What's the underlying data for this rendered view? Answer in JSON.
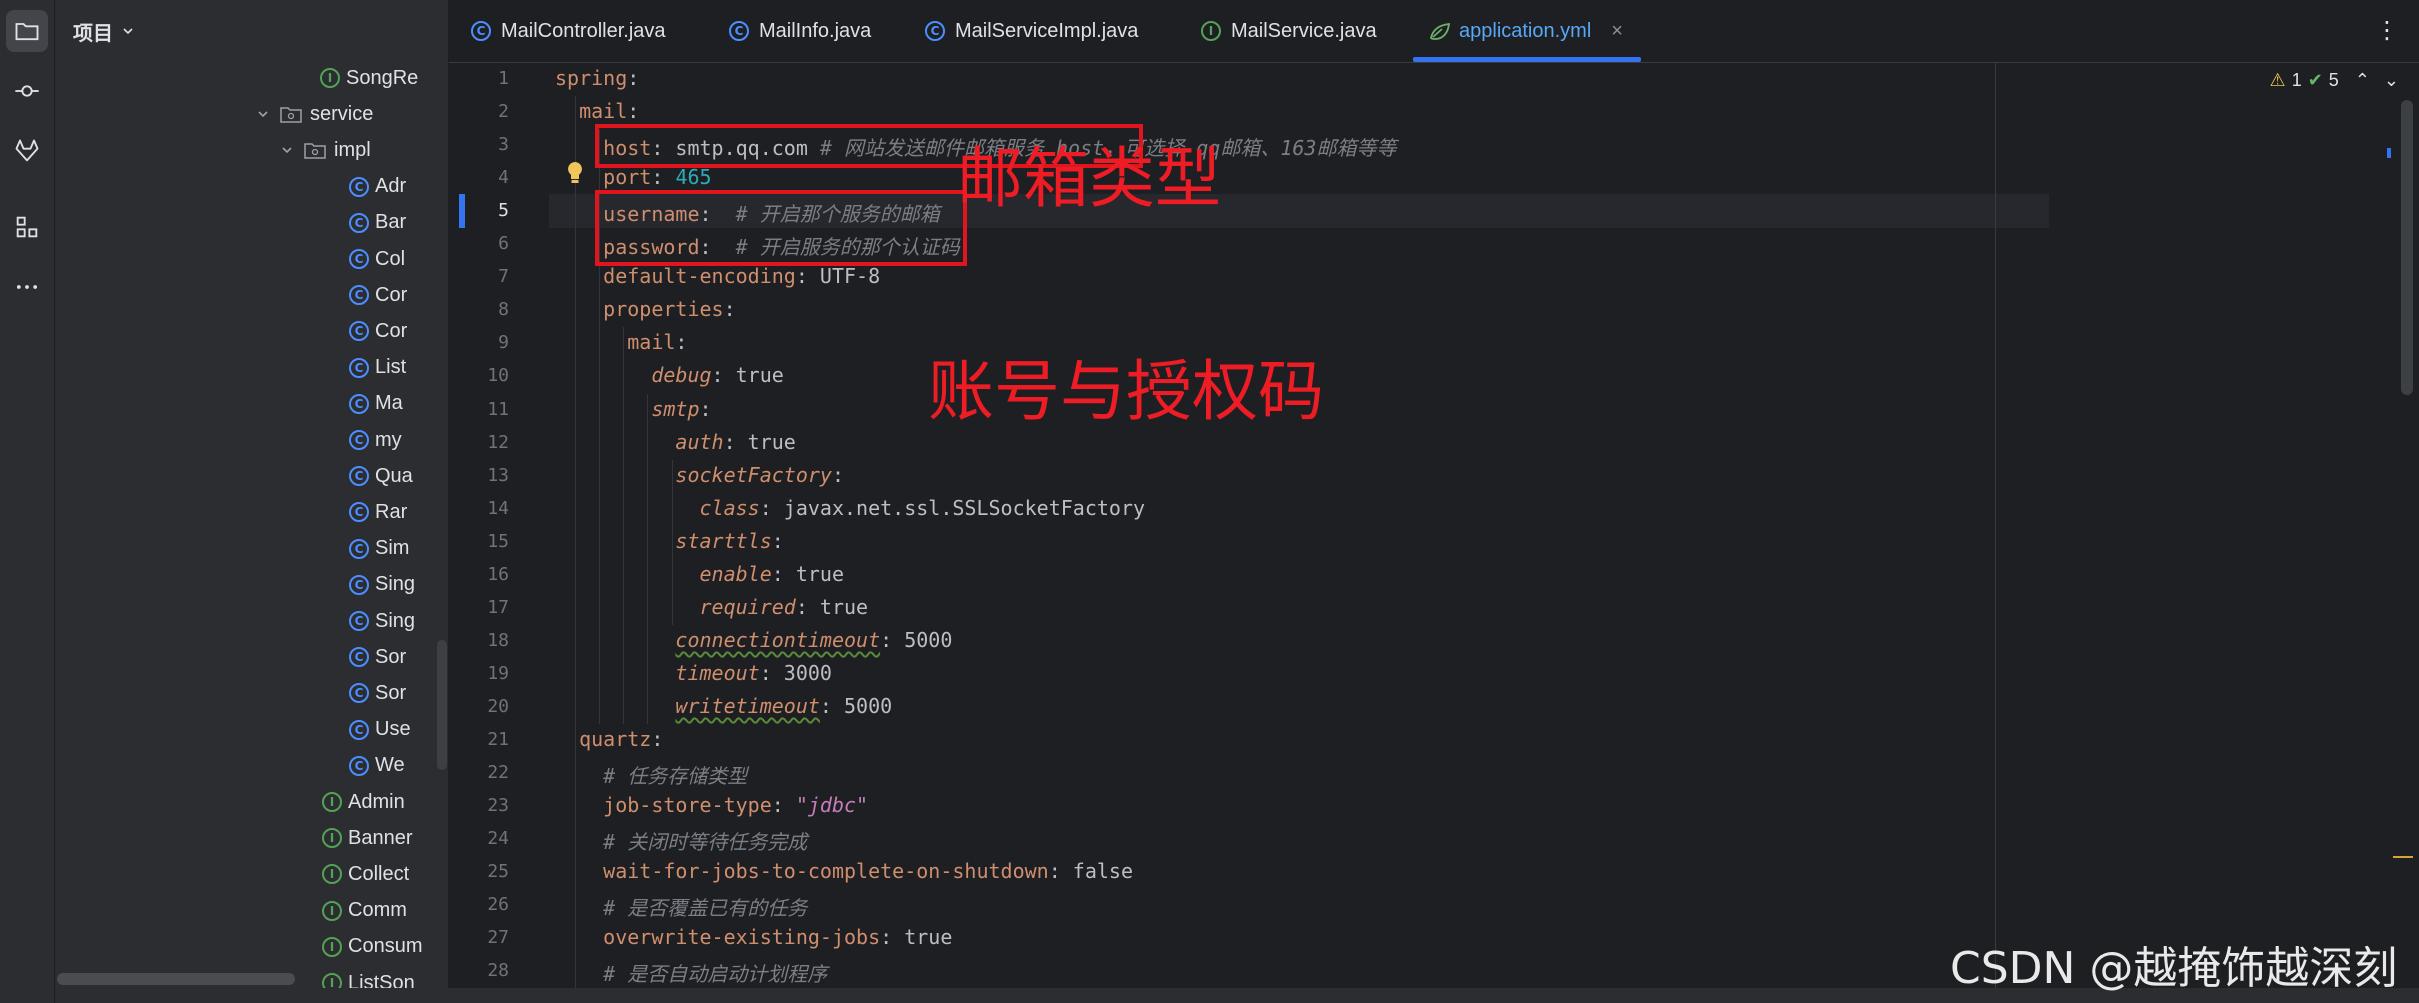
{
  "sidebar": {
    "icons": [
      "folder-icon",
      "commit-icon",
      "gitlab-icon",
      "structure-icon",
      "more-icon"
    ]
  },
  "project": {
    "title": "项目",
    "tree": [
      {
        "kind": "interface",
        "label": "SongRe",
        "depth": 3
      },
      {
        "kind": "package",
        "label": "service",
        "depth": 1,
        "expanded": true
      },
      {
        "kind": "package",
        "label": "impl",
        "depth": 2,
        "expanded": true
      },
      {
        "kind": "class",
        "label": "Adr",
        "depth": 3
      },
      {
        "kind": "class",
        "label": "Bar",
        "depth": 3
      },
      {
        "kind": "class",
        "label": "Col",
        "depth": 3
      },
      {
        "kind": "class",
        "label": "Cor",
        "depth": 3
      },
      {
        "kind": "class",
        "label": "Cor",
        "depth": 3
      },
      {
        "kind": "class",
        "label": "List",
        "depth": 3
      },
      {
        "kind": "class",
        "label": "Ma",
        "depth": 3
      },
      {
        "kind": "class",
        "label": "my",
        "depth": 3
      },
      {
        "kind": "class",
        "label": "Qua",
        "depth": 3
      },
      {
        "kind": "class",
        "label": "Rar",
        "depth": 3
      },
      {
        "kind": "class",
        "label": "Sim",
        "depth": 3
      },
      {
        "kind": "class",
        "label": "Sing",
        "depth": 3
      },
      {
        "kind": "class",
        "label": "Sing",
        "depth": 3
      },
      {
        "kind": "class",
        "label": "Sor",
        "depth": 3
      },
      {
        "kind": "class",
        "label": "Sor",
        "depth": 3
      },
      {
        "kind": "class",
        "label": "Use",
        "depth": 3
      },
      {
        "kind": "class",
        "label": "We",
        "depth": 3
      },
      {
        "kind": "interface",
        "label": "Admin",
        "depth": 2
      },
      {
        "kind": "interface",
        "label": "Banner",
        "depth": 2
      },
      {
        "kind": "interface",
        "label": "Collect",
        "depth": 2
      },
      {
        "kind": "interface",
        "label": "Comm",
        "depth": 2
      },
      {
        "kind": "interface",
        "label": "Consum",
        "depth": 2
      },
      {
        "kind": "interface",
        "label": "ListSon",
        "depth": 2
      }
    ]
  },
  "tabs": [
    {
      "label": "MailController.java",
      "kind": "class",
      "active": false
    },
    {
      "label": "MailInfo.java",
      "kind": "class",
      "active": false
    },
    {
      "label": "MailServiceImpl.java",
      "kind": "class",
      "active": false
    },
    {
      "label": "MailService.java",
      "kind": "interface",
      "active": false
    },
    {
      "label": "application.yml",
      "kind": "yaml",
      "active": true
    }
  ],
  "inspections": {
    "warnings": "1",
    "ok": "5"
  },
  "editor": {
    "current_line": 5,
    "lines": [
      [
        [
          "k",
          "spring"
        ],
        [
          "p",
          ":"
        ]
      ],
      [
        [
          "p",
          "  "
        ],
        [
          "k",
          "mail"
        ],
        [
          "p",
          ":"
        ]
      ],
      [
        [
          "p",
          "    "
        ],
        [
          "k",
          "host"
        ],
        [
          "p",
          ": smtp.qq.com "
        ],
        [
          "c",
          "# 网站发送邮件邮箱服务 host，可选择 qq邮箱、163邮箱等等"
        ]
      ],
      [
        [
          "p",
          "    "
        ],
        [
          "k",
          "port"
        ],
        [
          "p",
          ": "
        ],
        [
          "n",
          "465"
        ]
      ],
      [
        [
          "p",
          "    "
        ],
        [
          "k",
          "username"
        ],
        [
          "p",
          ":  "
        ],
        [
          "c",
          "# 开启那个服务的邮箱"
        ]
      ],
      [
        [
          "p",
          "    "
        ],
        [
          "k",
          "password"
        ],
        [
          "p",
          ":  "
        ],
        [
          "c",
          "# 开启服务的那个认证码"
        ]
      ],
      [
        [
          "p",
          "    "
        ],
        [
          "k",
          "default-encoding"
        ],
        [
          "p",
          ": UTF-8"
        ]
      ],
      [
        [
          "p",
          "    "
        ],
        [
          "k",
          "properties"
        ],
        [
          "p",
          ":"
        ]
      ],
      [
        [
          "p",
          "      "
        ],
        [
          "k",
          "mail"
        ],
        [
          "p",
          ":"
        ]
      ],
      [
        [
          "p",
          "        "
        ],
        [
          "ki",
          "debug"
        ],
        [
          "p",
          ": true"
        ]
      ],
      [
        [
          "p",
          "        "
        ],
        [
          "ki",
          "smtp"
        ],
        [
          "p",
          ":"
        ]
      ],
      [
        [
          "p",
          "          "
        ],
        [
          "ki",
          "auth"
        ],
        [
          "p",
          ": true"
        ]
      ],
      [
        [
          "p",
          "          "
        ],
        [
          "ki",
          "socketFactory"
        ],
        [
          "p",
          ":"
        ]
      ],
      [
        [
          "p",
          "            "
        ],
        [
          "ki",
          "class"
        ],
        [
          "p",
          ": javax.net.ssl.SSLSocketFactory"
        ]
      ],
      [
        [
          "p",
          "          "
        ],
        [
          "ki",
          "starttls"
        ],
        [
          "p",
          ":"
        ]
      ],
      [
        [
          "p",
          "            "
        ],
        [
          "ki",
          "enable"
        ],
        [
          "p",
          ": true"
        ]
      ],
      [
        [
          "p",
          "            "
        ],
        [
          "ki",
          "required"
        ],
        [
          "p",
          ": true"
        ]
      ],
      [
        [
          "p",
          "          "
        ],
        [
          "kw",
          "connectiontimeout"
        ],
        [
          "p",
          ": 5000"
        ]
      ],
      [
        [
          "p",
          "          "
        ],
        [
          "ki",
          "timeout"
        ],
        [
          "p",
          ": 3000"
        ]
      ],
      [
        [
          "p",
          "          "
        ],
        [
          "kw",
          "writetimeout"
        ],
        [
          "p",
          ": 5000"
        ]
      ],
      [
        [
          "p",
          "  "
        ],
        [
          "k",
          "quartz"
        ],
        [
          "p",
          ":"
        ]
      ],
      [
        [
          "p",
          "    "
        ],
        [
          "c",
          "# 任务存储类型"
        ]
      ],
      [
        [
          "p",
          "    "
        ],
        [
          "k",
          "job-store-type"
        ],
        [
          "p",
          ": "
        ],
        [
          "s",
          "\"jdbc\""
        ]
      ],
      [
        [
          "p",
          "    "
        ],
        [
          "c",
          "# 关闭时等待任务完成"
        ]
      ],
      [
        [
          "p",
          "    "
        ],
        [
          "k",
          "wait-for-jobs-to-complete-on-shutdown"
        ],
        [
          "p",
          ": false"
        ]
      ],
      [
        [
          "p",
          "    "
        ],
        [
          "c",
          "# 是否覆盖已有的任务"
        ]
      ],
      [
        [
          "p",
          "    "
        ],
        [
          "k",
          "overwrite-existing-jobs"
        ],
        [
          "p",
          ": true"
        ]
      ],
      [
        [
          "p",
          "    "
        ],
        [
          "c",
          "# 是否自动启动计划程序"
        ]
      ]
    ]
  },
  "annotations": {
    "mail_type": "邮箱类型",
    "account_auth": "账号与授权码"
  },
  "watermark": "CSDN @越掩饰越深刻",
  "colors": {
    "accent": "#3574f0",
    "annotation_red": "#e0151d",
    "background": "#1e1f22",
    "panel": "#2b2d30"
  }
}
